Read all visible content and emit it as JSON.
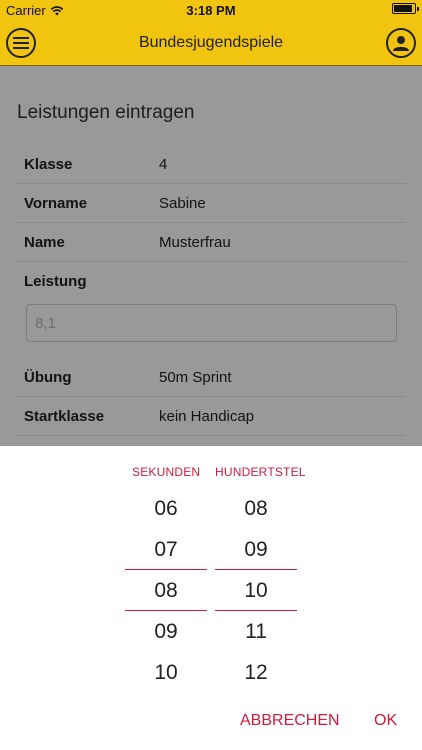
{
  "status_bar": {
    "carrier": "Carrier",
    "time": "3:18 PM",
    "battery_level": 0.95
  },
  "navbar": {
    "title": "Bundesjugendspiele",
    "menu_icon": "menu-icon",
    "profile_icon": "user-icon"
  },
  "form": {
    "heading": "Leistungen eintragen",
    "rows_top": [
      {
        "label": "Klasse",
        "value": "4"
      },
      {
        "label": "Vorname",
        "value": "Sabine"
      },
      {
        "label": "Name",
        "value": "Musterfrau"
      }
    ],
    "leistung_label": "Leistung",
    "leistung_placeholder": "8,1",
    "rows_bottom": [
      {
        "label": "Übung",
        "value": "50m Sprint"
      },
      {
        "label": "Startklasse",
        "value": "kein Handicap"
      }
    ]
  },
  "picker": {
    "col1_header": "SEKUNDEN",
    "col2_header": "HUNDERTSTEL",
    "col1_items": [
      "06",
      "07",
      "08",
      "09",
      "10"
    ],
    "col2_items": [
      "08",
      "09",
      "10",
      "11",
      "12"
    ],
    "col1_selected": "08",
    "col2_selected": "10",
    "cancel": "ABBRECHEN",
    "ok": "OK"
  },
  "colors": {
    "accent": "#f1c40f",
    "picker_accent": "#d11b3c"
  }
}
